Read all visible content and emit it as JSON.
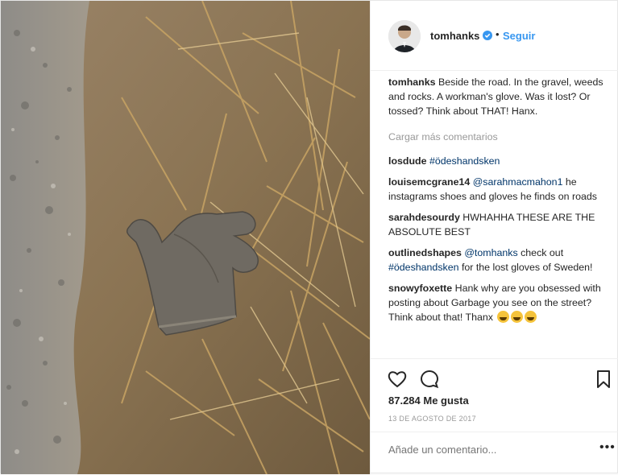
{
  "post": {
    "username": "tomhanks",
    "dot": "•",
    "follow_label": "Seguir",
    "caption_user": "tomhanks",
    "caption_text": " Beside the road. In the gravel, weeds and rocks. A workman's glove. Was it lost? Or tossed? Think about THAT! Hanx.",
    "load_more": "Cargar más comentarios",
    "likes": "87.284 Me gusta",
    "date": "13 DE AGOSTO DE 2017",
    "comment_placeholder": "Añade un comentario...",
    "options": "•••"
  },
  "comments": [
    {
      "user": "losdude",
      "pre": " ",
      "link": "#ödeshandsken",
      "post": ""
    },
    {
      "user": "louisemcgrane14",
      "pre": " ",
      "link": "@sarahmacmahon1",
      "post": " he instagrams shoes and gloves he finds on roads"
    },
    {
      "user": "sarahdesourdy",
      "pre": " HWHAHHA THESE ARE THE ABSOLUTE BEST",
      "link": "",
      "post": ""
    },
    {
      "user": "outlinedshapes",
      "pre": " ",
      "link": "@tomhanks",
      "post": " check out "
    },
    {
      "user": "snowyfoxette",
      "pre": " Hank why are you obsessed with posting about Garbage you see on the street? Think about that! Thanx",
      "link": "",
      "post": ""
    }
  ],
  "comment3_link2": "#ödeshandsken",
  "comment3_tail": " for the lost gloves of Sweden!",
  "icons": [
    "heart-icon",
    "comment-icon",
    "bookmark-icon",
    "verified-badge-icon"
  ],
  "colors": {
    "link": "#003569",
    "follow": "#3897f0",
    "verified": "#3897f0",
    "muted": "#999999"
  }
}
